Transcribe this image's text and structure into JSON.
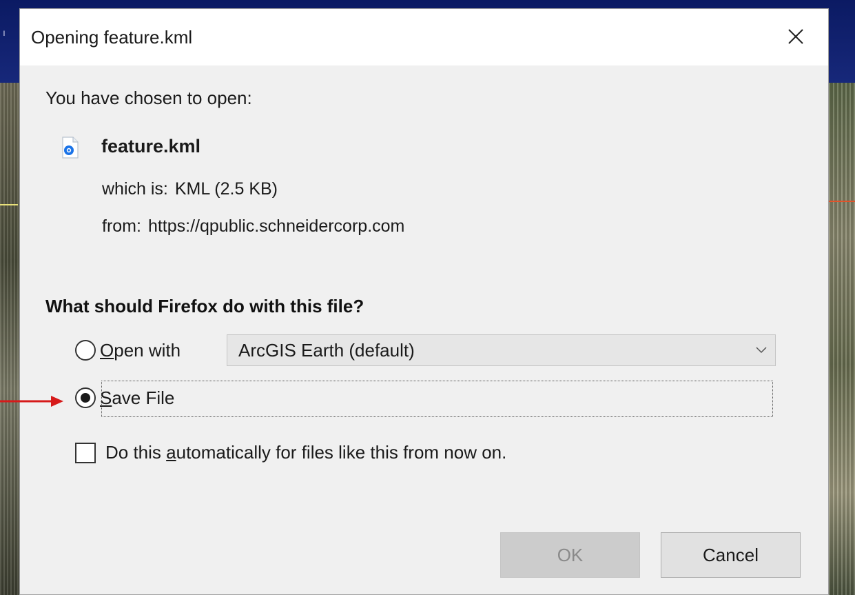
{
  "dialog": {
    "title": "Opening feature.kml",
    "close_icon": "close-icon",
    "intro": "You have chosen to open:",
    "file": {
      "icon": "kml-file-icon",
      "name": "feature.kml",
      "which_is_label": "which is:",
      "which_is_value": "KML (2.5 KB)",
      "from_label": "from:",
      "from_value": "https://qpublic.schneidercorp.com"
    },
    "question": "What should Firefox do with this file?",
    "options": {
      "open_with": {
        "label_prefix": "O",
        "label_rest": "pen with",
        "checked": false,
        "app_select_value": "ArcGIS Earth (default)"
      },
      "save_file": {
        "label_prefix": "S",
        "label_rest": "ave File",
        "checked": true
      }
    },
    "auto_checkbox": {
      "label_before": "Do this ",
      "label_underlined": "a",
      "label_after": "utomatically for files like this from now on.",
      "checked": false
    },
    "buttons": {
      "ok": "OK",
      "ok_enabled": false,
      "cancel": "Cancel"
    }
  },
  "annotation": {
    "arrow_color": "#d61a1a"
  },
  "colors": {
    "dialog_bg": "#f0f0f0",
    "titlebar_bg": "#ffffff",
    "background_top": "#0b1a63"
  }
}
